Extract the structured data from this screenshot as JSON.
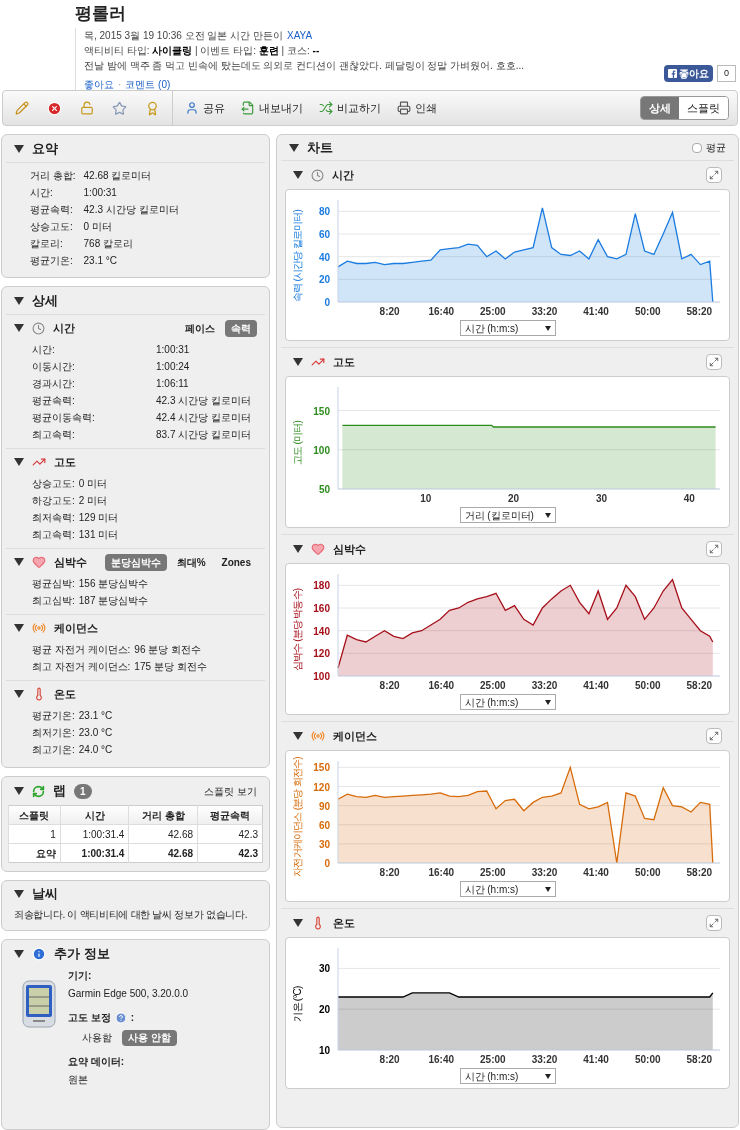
{
  "header": {
    "title": "평롤러",
    "meta": "목, 2015 3월 19 10:36 오전 일본 시간 만든이",
    "author": "XAYA",
    "activity_line": "액티비티 타입: **사이클링** | 이벤트 타입: **훈련** | 코스: **--**",
    "description": "전날 밤에 맥주 좀 먹고 빈속에 탔는데도 의외로 컨디션이 괜찮았다. 페달링이 정말 가벼웠어. 호호...",
    "like_link": "좋아요",
    "separator": "·",
    "comment_link": "코멘트 (0)",
    "fb_like": "좋아요",
    "fb_count": "0"
  },
  "toolbar": {
    "actions": [
      {
        "kind": "share",
        "label": "공유"
      },
      {
        "kind": "export",
        "label": "내보내기"
      },
      {
        "kind": "compare",
        "label": "비교하기"
      },
      {
        "kind": "print",
        "label": "인쇄"
      }
    ],
    "view_toggle": [
      {
        "label": "상세",
        "selected": true
      },
      {
        "label": "스플릿",
        "selected": false
      }
    ]
  },
  "summary": {
    "title": "요약",
    "rows": [
      {
        "label": "거리 총합:",
        "value": "42.68 킬로미터"
      },
      {
        "label": "시간:",
        "value": "1:00:31"
      },
      {
        "label": "평균속력:",
        "value": "42.3 시간당 킬로미터"
      },
      {
        "label": "상승고도:",
        "value": "0 미터"
      },
      {
        "label": "칼로리:",
        "value": "768 칼로리"
      },
      {
        "label": "평균기온:",
        "value": "23.1 °C"
      }
    ]
  },
  "details": {
    "title": "상세",
    "sections": [
      {
        "kind": "time",
        "title": "시간",
        "toggles": [
          {
            "label": "페이스",
            "selected": false
          },
          {
            "label": "속력",
            "selected": true
          }
        ],
        "rows": [
          {
            "label": "시간:",
            "value": "1:00:31"
          },
          {
            "label": "이동시간:",
            "value": "1:00:24"
          },
          {
            "label": "경과시간:",
            "value": "1:06:11"
          },
          {
            "label": "평균속력:",
            "value": "42.3 시간당 킬로미터"
          },
          {
            "label": "평균이동속력:",
            "value": "42.4 시간당 킬로미터"
          },
          {
            "label": "최고속력:",
            "value": "83.7 시간당 킬로미터"
          }
        ]
      },
      {
        "kind": "elevation",
        "title": "고도",
        "rows": [
          {
            "label": "상승고도:",
            "value": "0 미터"
          },
          {
            "label": "하강고도:",
            "value": "2 미터"
          },
          {
            "label": "최저속력:",
            "value": "129 미터"
          },
          {
            "label": "최고속력:",
            "value": "131 미터"
          }
        ]
      },
      {
        "kind": "heart",
        "title": "심박수",
        "toggles": [
          {
            "label": "분당심박수",
            "selected": true
          },
          {
            "label": "최대%",
            "selected": false
          },
          {
            "label": "Zones",
            "selected": false
          }
        ],
        "rows": [
          {
            "label": "평균심박:",
            "value": "156 분당심박수"
          },
          {
            "label": "최고심박:",
            "value": "187 분당심박수"
          }
        ]
      },
      {
        "kind": "cadence",
        "title": "케이던스",
        "rows": [
          {
            "label": "평균 자전거 케이던스:",
            "value": "96 분당 회전수"
          },
          {
            "label": "최고 자전거 케이던스:",
            "value": "175 분당 회전수"
          }
        ]
      },
      {
        "kind": "temperature",
        "title": "온도",
        "rows": [
          {
            "label": "평균기온:",
            "value": "23.1 °C"
          },
          {
            "label": "최저기온:",
            "value": "23.0 °C"
          },
          {
            "label": "최고기온:",
            "value": "24.0 °C"
          }
        ]
      }
    ]
  },
  "laps": {
    "title": "랩",
    "count": "1",
    "link": "스플릿 보기",
    "columns": [
      "스플릿",
      "시간",
      "거리 총합",
      "평균속력"
    ],
    "rows": [
      {
        "kind": "lap",
        "cells": [
          "1",
          "1:00:31.4",
          "42.68",
          "42.3"
        ]
      },
      {
        "kind": "total",
        "cells": [
          "요약",
          "1:00:31.4",
          "42.68",
          "42.3"
        ]
      }
    ]
  },
  "weather": {
    "title": "날씨",
    "message": "죄송합니다. 이 액티비티에 대한 날씨 정보가 없습니다."
  },
  "extra": {
    "title": "추가 정보",
    "device_label": "기기:",
    "device": "Garmin Edge 500, 3.20.0.0",
    "elevation_label": "고도 보정",
    "elevation_suffix": ":",
    "elevation_options": [
      {
        "label": "사용함",
        "selected": false
      },
      {
        "label": "사용 안함",
        "selected": true
      }
    ],
    "summary_label": "요약 데이터:",
    "summary_value": "원본"
  },
  "charts": {
    "title": "차트",
    "average": {
      "label": "평균",
      "checked": false
    },
    "items": [
      {
        "kind": "time",
        "title": "시간",
        "axis_select": "시간 (h:m:s)",
        "chart_data": {
          "type": "area",
          "grid": true,
          "ylabel": "속력 (시간당 킬로미터)",
          "xlim": [
            0,
            3700
          ],
          "ylim": [
            0,
            90
          ],
          "yticks": [
            0,
            20,
            40,
            60,
            80
          ],
          "xticks": [
            {
              "value": 500,
              "label": "8:20"
            },
            {
              "value": 1000,
              "label": "16:40"
            },
            {
              "value": 1500,
              "label": "25:00"
            },
            {
              "value": 2000,
              "label": "33:20"
            },
            {
              "value": 2500,
              "label": "41:40"
            },
            {
              "value": 3000,
              "label": "50:00"
            },
            {
              "value": 3500,
              "label": "58:20"
            }
          ],
          "x": [
            0,
            90,
            180,
            270,
            360,
            450,
            540,
            630,
            720,
            810,
            900,
            990,
            1080,
            1170,
            1260,
            1350,
            1440,
            1530,
            1620,
            1710,
            1800,
            1890,
            1980,
            2070,
            2160,
            2250,
            2340,
            2430,
            2520,
            2610,
            2700,
            2790,
            2880,
            2970,
            3060,
            3150,
            3240,
            3330,
            3420,
            3510,
            3600,
            3630
          ],
          "series": [
            {
              "color": "#1a7be0",
              "values": [
                31,
                36,
                34,
                34,
                35,
                33,
                34,
                34,
                35,
                36,
                37,
                46,
                47,
                48,
                51,
                50,
                40,
                45,
                38,
                44,
                46,
                48,
                83,
                48,
                42,
                41,
                45,
                38,
                55,
                40,
                38,
                42,
                78,
                45,
                42,
                60,
                79,
                38,
                42,
                33,
                36,
                0
              ]
            }
          ]
        }
      },
      {
        "kind": "elevation",
        "title": "고도",
        "axis_select": "거리 (킬로미터)",
        "chart_data": {
          "type": "area",
          "grid": true,
          "ylabel": "고도 (미터)",
          "xlim": [
            0,
            43.5
          ],
          "ylim": [
            50,
            180
          ],
          "yticks": [
            50,
            100,
            150
          ],
          "xticks": [
            10,
            20,
            30,
            40
          ],
          "x": [
            0.5,
            17.5,
            17.7,
            43
          ],
          "series": [
            {
              "color": "#2e8b1e",
              "values": [
                131,
                131,
                129,
                129
              ]
            }
          ]
        }
      },
      {
        "kind": "heart",
        "title": "심박수",
        "axis_select": "시간 (h:m:s)",
        "chart_data": {
          "type": "area",
          "grid": true,
          "ylabel": "심박수 (분당 박동수)",
          "xlim": [
            0,
            3700
          ],
          "ylim": [
            100,
            190
          ],
          "yticks": [
            100,
            120,
            140,
            160,
            180
          ],
          "xticks": [
            {
              "value": 500,
              "label": "8:20"
            },
            {
              "value": 1000,
              "label": "16:40"
            },
            {
              "value": 1500,
              "label": "25:00"
            },
            {
              "value": 2000,
              "label": "33:20"
            },
            {
              "value": 2500,
              "label": "41:40"
            },
            {
              "value": 3000,
              "label": "50:00"
            },
            {
              "value": 3500,
              "label": "58:20"
            }
          ],
          "x": [
            0,
            90,
            180,
            270,
            360,
            450,
            540,
            630,
            720,
            810,
            900,
            990,
            1080,
            1170,
            1260,
            1350,
            1440,
            1530,
            1620,
            1710,
            1800,
            1890,
            1980,
            2070,
            2160,
            2250,
            2340,
            2430,
            2520,
            2610,
            2700,
            2790,
            2880,
            2970,
            3060,
            3150,
            3240,
            3330,
            3420,
            3510,
            3600,
            3630
          ],
          "series": [
            {
              "color": "#a50f1a",
              "values": [
                107,
                136,
                132,
                130,
                135,
                140,
                135,
                133,
                138,
                140,
                145,
                150,
                158,
                160,
                165,
                168,
                170,
                173,
                158,
                162,
                150,
                145,
                160,
                168,
                175,
                180,
                165,
                155,
                175,
                150,
                160,
                180,
                170,
                150,
                160,
                175,
                185,
                160,
                150,
                140,
                135,
                130
              ]
            }
          ]
        }
      },
      {
        "kind": "cadence",
        "title": "케이던스",
        "axis_select": "시간 (h:m:s)",
        "chart_data": {
          "type": "area",
          "grid": true,
          "ylabel": "자전거케이던스 (분당 회전수)",
          "xlim": [
            0,
            3700
          ],
          "ylim": [
            0,
            160
          ],
          "yticks": [
            0,
            30,
            60,
            90,
            120,
            150
          ],
          "xticks": [
            {
              "value": 500,
              "label": "8:20"
            },
            {
              "value": 1000,
              "label": "16:40"
            },
            {
              "value": 1500,
              "label": "25:00"
            },
            {
              "value": 2000,
              "label": "33:20"
            },
            {
              "value": 2500,
              "label": "41:40"
            },
            {
              "value": 3000,
              "label": "50:00"
            },
            {
              "value": 3500,
              "label": "58:20"
            }
          ],
          "x": [
            0,
            90,
            180,
            270,
            360,
            450,
            540,
            630,
            720,
            810,
            900,
            990,
            1080,
            1170,
            1260,
            1350,
            1440,
            1530,
            1620,
            1710,
            1800,
            1890,
            1980,
            2070,
            2160,
            2250,
            2340,
            2430,
            2520,
            2610,
            2700,
            2790,
            2880,
            2970,
            3060,
            3150,
            3240,
            3330,
            3420,
            3510,
            3600,
            3630
          ],
          "series": [
            {
              "color": "#d76b0a",
              "values": [
                100,
                108,
                104,
                103,
                106,
                103,
                104,
                105,
                106,
                107,
                108,
                110,
                105,
                104,
                106,
                112,
                113,
                85,
                98,
                100,
                82,
                95,
                103,
                105,
                110,
                150,
                92,
                85,
                88,
                95,
                0,
                110,
                105,
                70,
                68,
                118,
                90,
                88,
                80,
                95,
                92,
                0
              ]
            }
          ]
        }
      },
      {
        "kind": "temperature",
        "title": "온도",
        "axis_select": "시간 (h:m:s)",
        "chart_data": {
          "type": "area",
          "grid": true,
          "ylabel": "기온 (°C)",
          "xlim": [
            0,
            3700
          ],
          "ylim": [
            10,
            35
          ],
          "yticks": [
            10,
            20,
            30
          ],
          "xticks": [
            {
              "value": 500,
              "label": "8:20"
            },
            {
              "value": 1000,
              "label": "16:40"
            },
            {
              "value": 1500,
              "label": "25:00"
            },
            {
              "value": 2000,
              "label": "33:20"
            },
            {
              "value": 2500,
              "label": "41:40"
            },
            {
              "value": 3000,
              "label": "50:00"
            },
            {
              "value": 3500,
              "label": "58:20"
            }
          ],
          "x": [
            0,
            90,
            180,
            270,
            360,
            450,
            540,
            630,
            720,
            810,
            900,
            990,
            1080,
            1170,
            1260,
            1350,
            1440,
            1530,
            1620,
            1710,
            1800,
            1890,
            1980,
            2070,
            2160,
            2250,
            2340,
            2430,
            2520,
            2610,
            2700,
            2790,
            2880,
            2970,
            3060,
            3150,
            3240,
            3330,
            3420,
            3510,
            3600,
            3630
          ],
          "series": [
            {
              "color": "#000000",
              "values": [
                23,
                23,
                23,
                23,
                23,
                23,
                23,
                23,
                24,
                24,
                24,
                24,
                24,
                23,
                23,
                23,
                23,
                23,
                23,
                23,
                23,
                23,
                23,
                23,
                23,
                23,
                23,
                23,
                23,
                23,
                23,
                23,
                23,
                23,
                23,
                23,
                23,
                23,
                23,
                23,
                23,
                24
              ]
            }
          ]
        }
      }
    ]
  }
}
